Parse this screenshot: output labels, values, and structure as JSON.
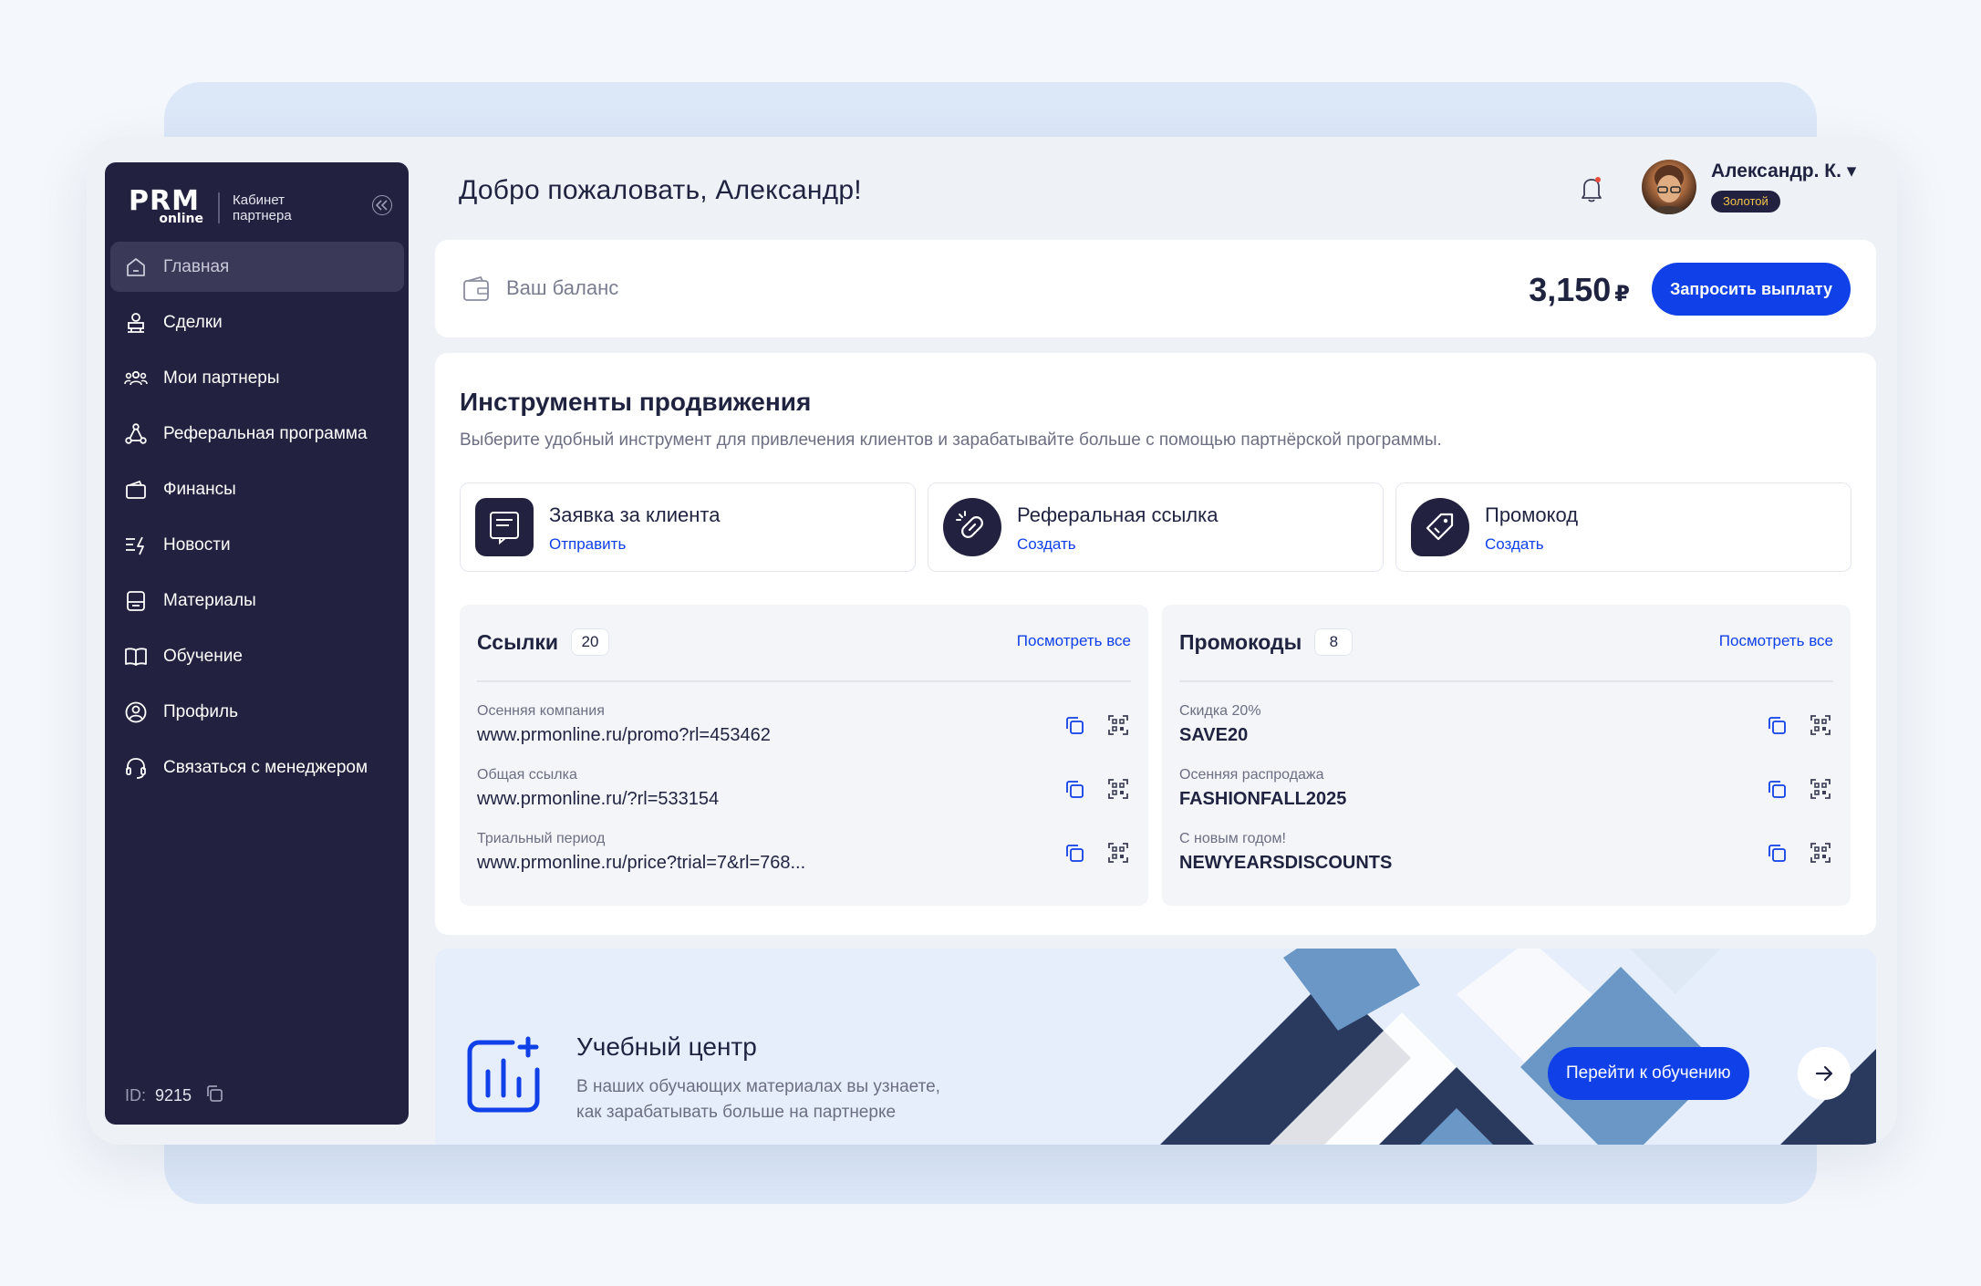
{
  "sidebar": {
    "logo_line1": "PRM",
    "logo_line2": "online",
    "subtitle_line1": "Кабинет",
    "subtitle_line2": "партнера",
    "items": [
      {
        "label": "Главная",
        "icon": "home-icon"
      },
      {
        "label": "Сделки",
        "icon": "deals-icon"
      },
      {
        "label": "Мои партнеры",
        "icon": "partners-icon"
      },
      {
        "label": "Реферальная программа",
        "icon": "referral-icon"
      },
      {
        "label": "Финансы",
        "icon": "wallet-icon"
      },
      {
        "label": "Новости",
        "icon": "news-icon"
      },
      {
        "label": "Материалы",
        "icon": "materials-icon"
      },
      {
        "label": "Обучение",
        "icon": "book-icon"
      },
      {
        "label": "Профиль",
        "icon": "profile-icon"
      },
      {
        "label": "Связаться с менеджером",
        "icon": "headset-icon"
      }
    ],
    "active_index": 0,
    "id_label": "ID:",
    "id_value": "9215"
  },
  "header": {
    "greeting": "Добро пожаловать, Александр!",
    "user_name": "Александр. К. ▾",
    "user_badge": "Золотой"
  },
  "balance": {
    "label": "Ваш баланс",
    "amount": "3,150",
    "currency": "₽",
    "payout_label": "Запросить выплату"
  },
  "promo": {
    "title": "Инструменты продвижения",
    "subtitle": "Выберите удобный инструмент для привлечения клиентов и зарабатывайте больше с помощью партнёрской программы.",
    "tools": [
      {
        "name": "Заявка за клиента",
        "action": "Отправить"
      },
      {
        "name": "Реферальная ссылка",
        "action": "Создать"
      },
      {
        "name": "Промокод",
        "action": "Создать"
      }
    ],
    "links": {
      "title": "Ссылки",
      "count": "20",
      "view_all": "Посмотреть все",
      "rows": [
        {
          "label": "Осенняя компания",
          "value": "www.prmonline.ru/promo?rl=453462"
        },
        {
          "label": "Общая ссылка",
          "value": "www.prmonline.ru/?rl=533154"
        },
        {
          "label": "Триальный период",
          "value": "www.prmonline.ru/price?trial=7&rl=768..."
        }
      ]
    },
    "promocodes": {
      "title": "Промокоды",
      "count": "8",
      "view_all": "Посмотреть все",
      "rows": [
        {
          "label": "Скидка 20%",
          "value": "SAVE20"
        },
        {
          "label": "Осенняя распродажа",
          "value": "FASHIONFALL2025"
        },
        {
          "label": "С новым годом!",
          "value": "NEWYEARSDISCOUNTS"
        }
      ]
    }
  },
  "education": {
    "title": "Учебный центр",
    "subtitle_line1": "В наших обучающих материалах вы узнаете,",
    "subtitle_line2": "как зарабатывать больше на партнерке",
    "button": "Перейти к обучению"
  },
  "colors": {
    "sidebar_bg": "#22213f",
    "accent": "#1040e8",
    "badge_text": "#f2c44d"
  }
}
